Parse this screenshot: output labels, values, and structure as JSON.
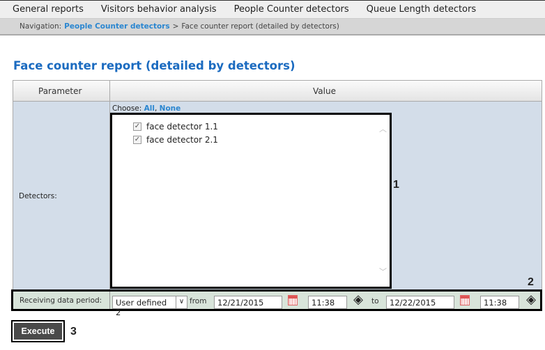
{
  "topnav": [
    "General reports",
    "Visitors behavior analysis",
    "People Counter detectors",
    "Queue Length detectors"
  ],
  "breadcrumb": {
    "prefix": "Navigation:",
    "link": "People Counter detectors",
    "separator": ">",
    "current": "Face counter report (detailed by detectors)"
  },
  "title": "Face counter report (detailed by detectors)",
  "table": {
    "col_parameter": "Parameter",
    "col_value": "Value",
    "detectors": {
      "label": "Detectors:",
      "choose": "Choose:",
      "all": "All",
      "comma": ",",
      "none": "None",
      "items": [
        {
          "label": "face detector 1.1",
          "checked": true
        },
        {
          "label": "face detector 2.1",
          "checked": true
        }
      ]
    },
    "period": {
      "label": "Receiving data period:",
      "select": "User defined 2",
      "from_label": "from",
      "from_date": "12/21/2015",
      "from_time": "11:38",
      "to_label": "to",
      "to_date": "12/22/2015",
      "to_time": "11:38"
    }
  },
  "execute": "Execute",
  "callouts": [
    "1",
    "2",
    "3"
  ]
}
